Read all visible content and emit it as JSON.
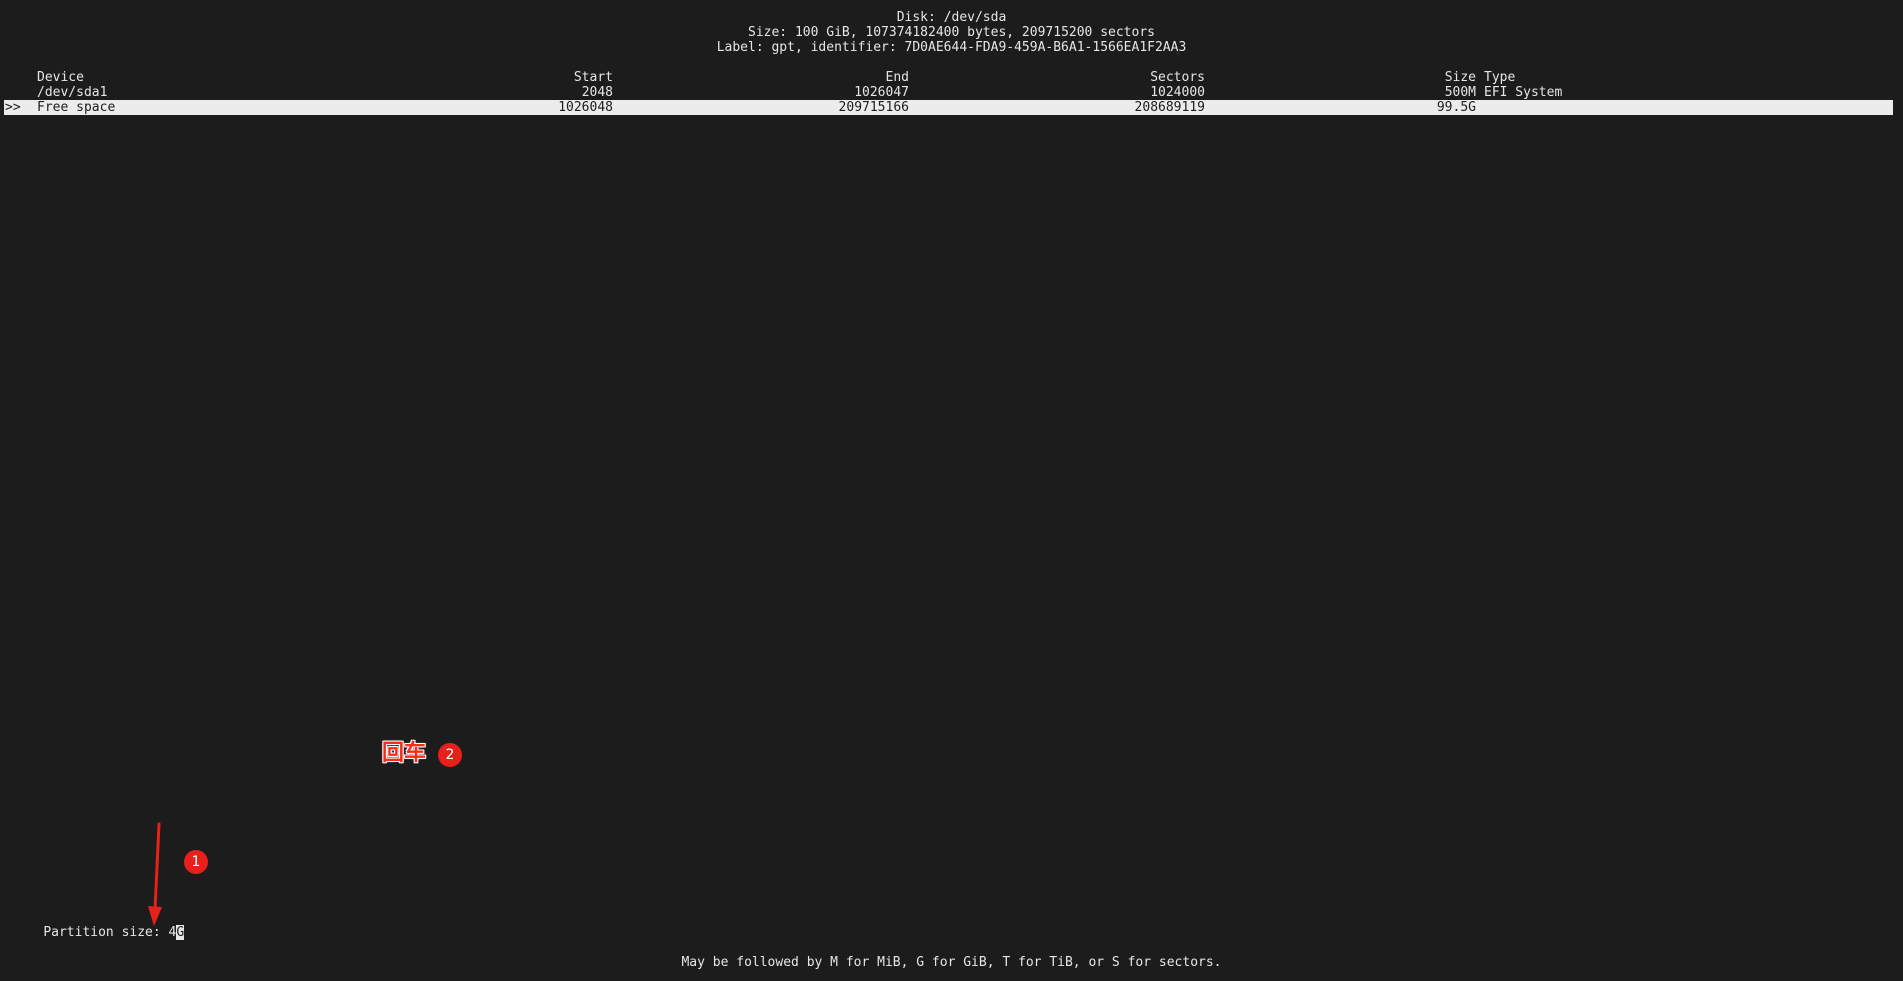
{
  "disk": {
    "title": "Disk: /dev/sda",
    "size_line": "Size: 100 GiB, 107374182400 bytes, 209715200 sectors",
    "label_line": "Label: gpt, identifier: 7D0AE644-FDA9-459A-B6A1-1566EA1F2AA3"
  },
  "table": {
    "headers": {
      "device": "Device",
      "start": "Start",
      "end": "End",
      "sectors": "Sectors",
      "size": "Size",
      "type": "Type"
    },
    "rows": [
      {
        "marker": "",
        "device": "/dev/sda1",
        "start": "2048",
        "end": "1026047",
        "sectors": "1024000",
        "size": "500M",
        "type": "EFI System"
      },
      {
        "marker": ">>",
        "device": "Free space",
        "start": "1026048",
        "end": "209715166",
        "sectors": "208689119",
        "size": "99.5G",
        "type": ""
      }
    ]
  },
  "prompt": {
    "label": "Partition size: ",
    "value": "4",
    "cursor_char": "G"
  },
  "hint": "May be followed by M for MiB, G for GiB, T for TiB, or S for sectors.",
  "annotations": {
    "step1": "1",
    "step2": "2",
    "step2_text": "回车",
    "color": "#e8201c"
  }
}
